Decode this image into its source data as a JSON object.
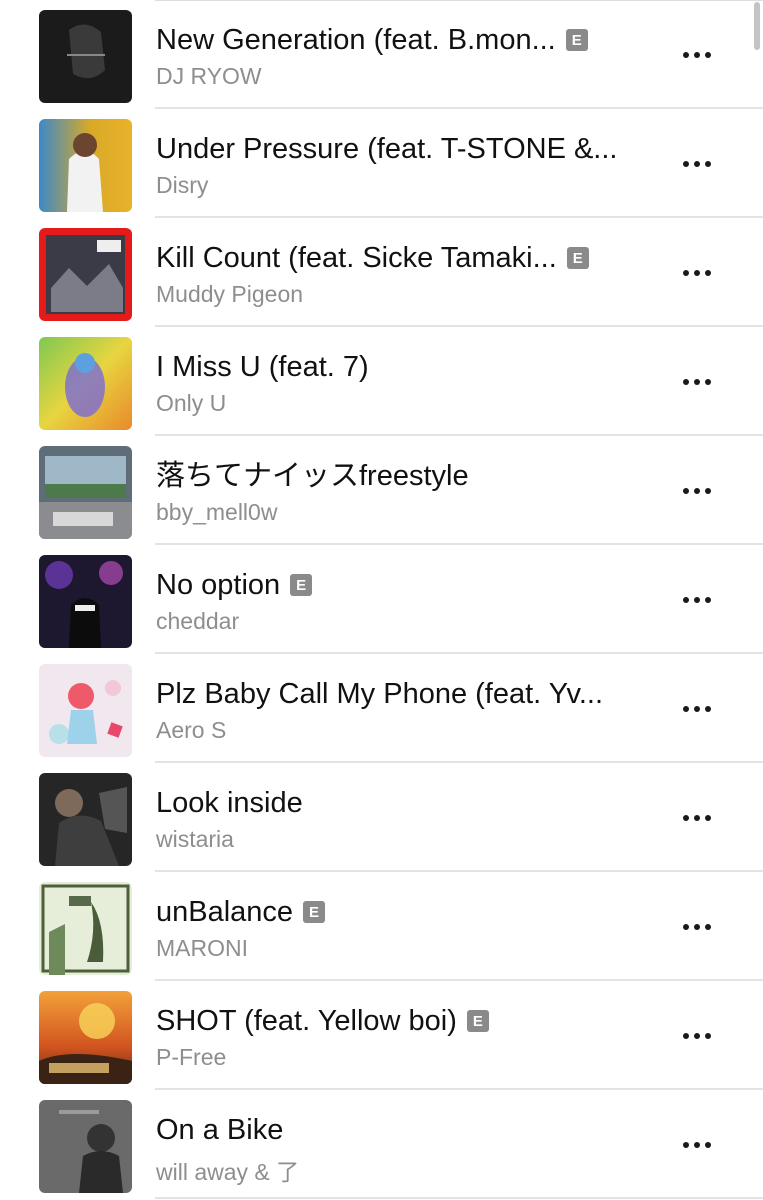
{
  "explicit_label": "E",
  "songs": [
    {
      "title": "New Generation (feat. B.mon...",
      "artist": "DJ RYOW",
      "explicit": true
    },
    {
      "title": "Under Pressure (feat. T-STONE &...",
      "artist": "Disry",
      "explicit": false
    },
    {
      "title": "Kill Count (feat. Sicke Tamaki...",
      "artist": "Muddy Pigeon",
      "explicit": true
    },
    {
      "title": "I Miss U (feat. 7)",
      "artist": "Only U",
      "explicit": false
    },
    {
      "title": "落ちてナイッスfreestyle",
      "artist": "bby_mell0w",
      "explicit": false
    },
    {
      "title": "No option",
      "artist": "cheddar",
      "explicit": true
    },
    {
      "title": "Plz Baby Call My Phone (feat. Yv...",
      "artist": "Aero S",
      "explicit": false
    },
    {
      "title": "Look inside",
      "artist": "wistaria",
      "explicit": false
    },
    {
      "title": "unBalance",
      "artist": "MARONI",
      "explicit": true
    },
    {
      "title": "SHOT (feat. Yellow boi)",
      "artist": "P-Free",
      "explicit": true
    },
    {
      "title": "On a Bike",
      "artist": "will away & 了",
      "explicit": false
    }
  ]
}
